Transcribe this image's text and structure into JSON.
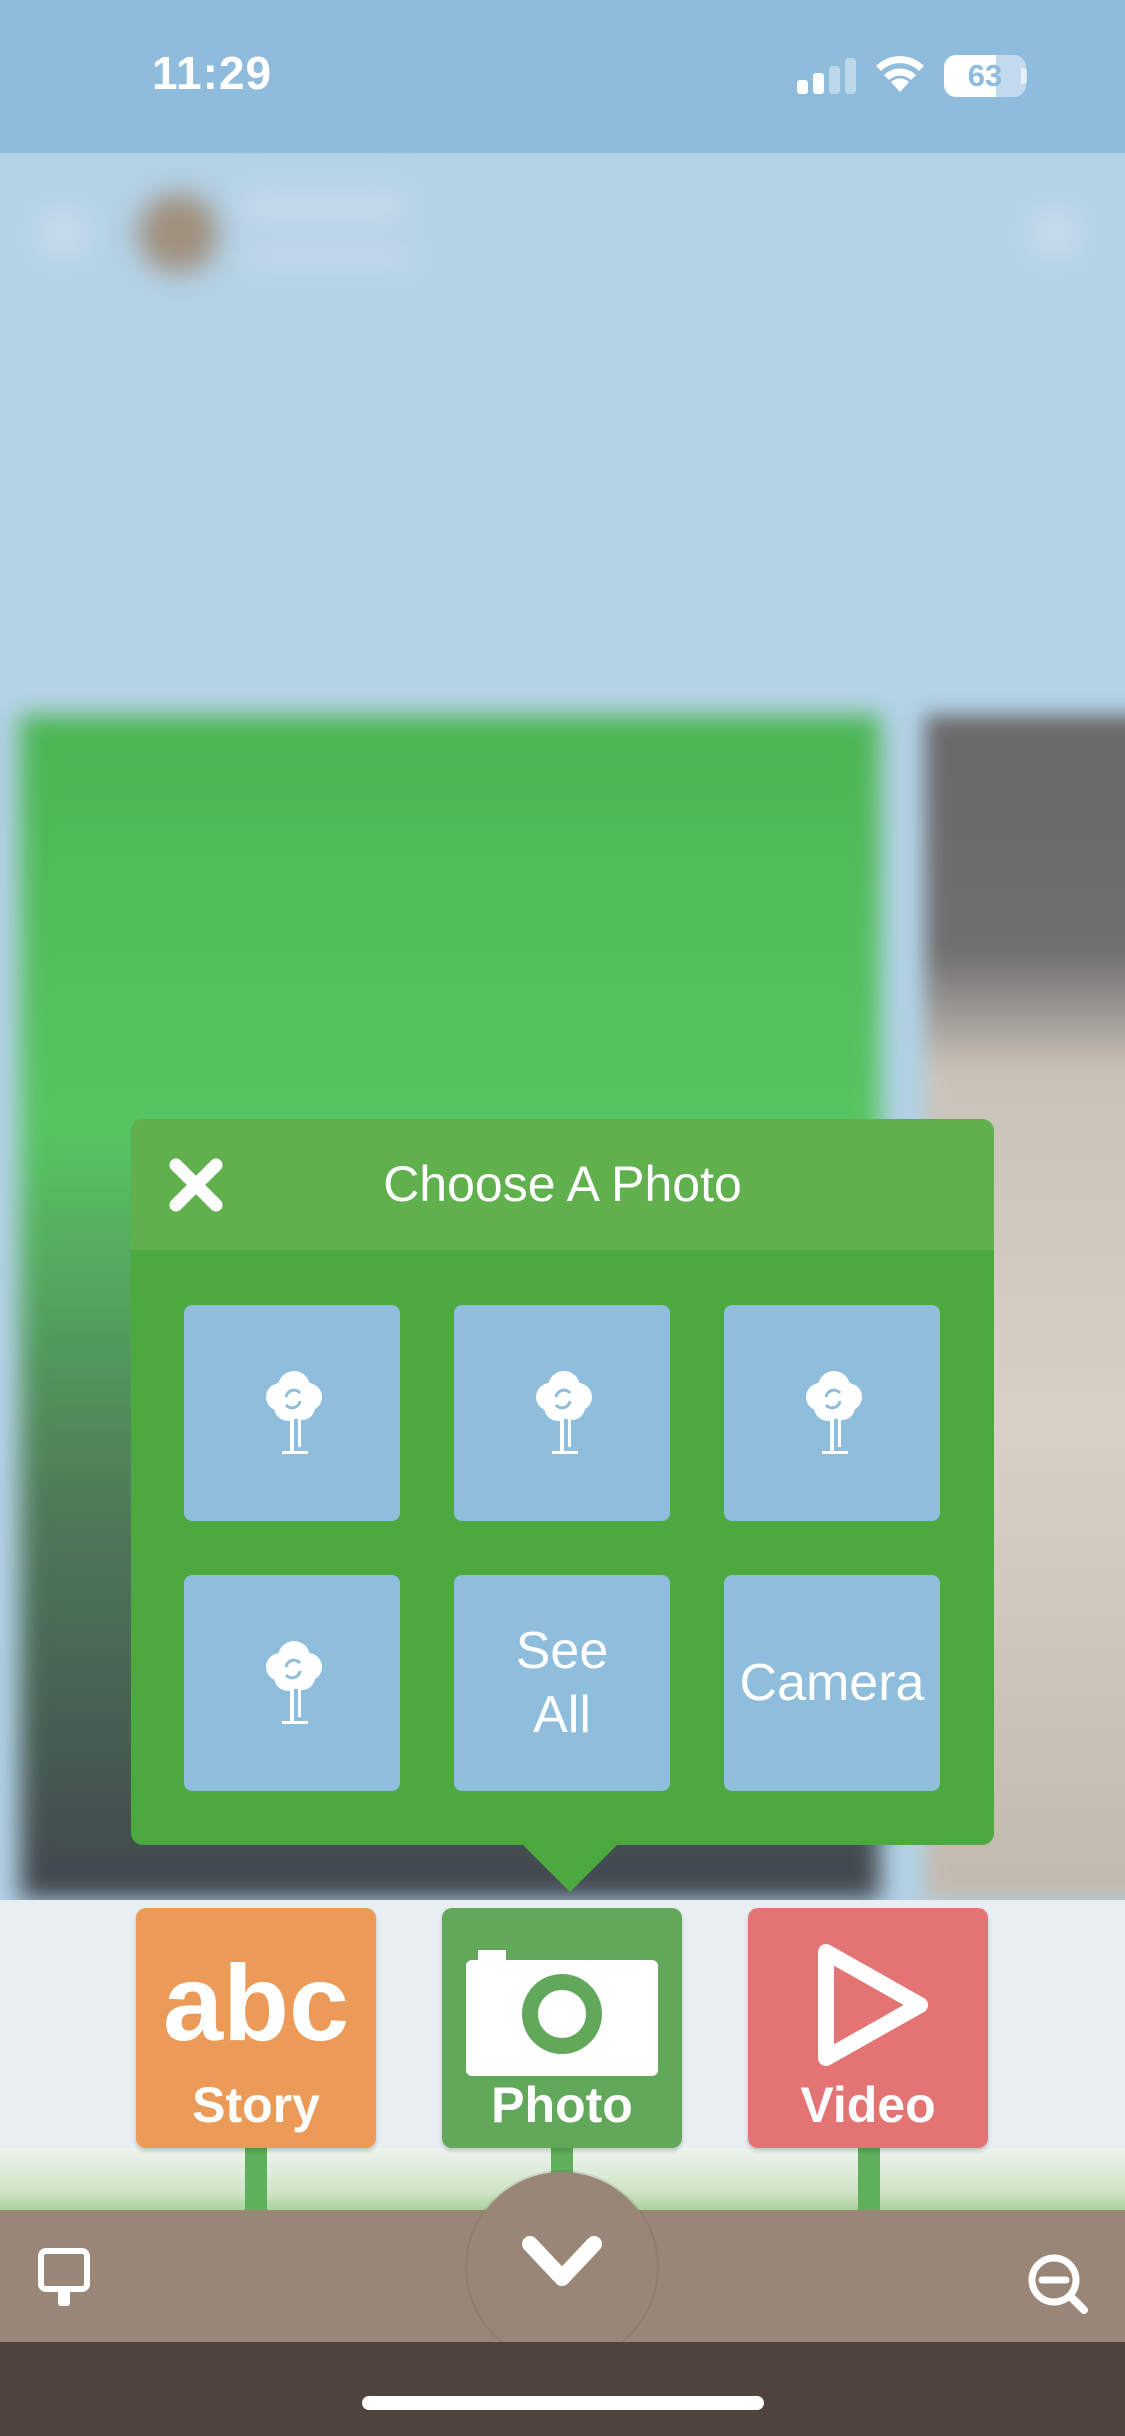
{
  "status_bar": {
    "time": "11:29",
    "battery_percent": 63,
    "battery_label": "63",
    "signal_bars_active": 2,
    "signal_bars_total": 4
  },
  "popup": {
    "title": "Choose A Photo",
    "tiles": [
      {
        "type": "icon",
        "icon": "photo-loading-icon"
      },
      {
        "type": "icon",
        "icon": "photo-loading-icon"
      },
      {
        "type": "icon",
        "icon": "photo-loading-icon"
      },
      {
        "type": "icon",
        "icon": "photo-loading-icon"
      },
      {
        "type": "text",
        "label": "See\nAll"
      },
      {
        "type": "text",
        "label": "Camera"
      }
    ],
    "see_all_label_line1": "See",
    "see_all_label_line2": "All",
    "camera_label": "Camera"
  },
  "categories": [
    {
      "label": "Story",
      "icon": "abc-icon",
      "color": "#ec9a58"
    },
    {
      "label": "Photo",
      "icon": "camera-icon",
      "color": "#62a85a"
    },
    {
      "label": "Video",
      "icon": "play-icon",
      "color": "#e47474"
    }
  ],
  "toolbar": {
    "left_icon": "pin-icon",
    "center_icon": "chevron-down-icon",
    "right_icon": "zoom-out-icon"
  },
  "colors": {
    "status_bar": "#8fbcdc",
    "popup_body": "#4ca93f",
    "popup_header": "#61b04e",
    "tile": "#8fbedc",
    "bottom_bar": "#9a8676",
    "home_area": "#4f433e"
  }
}
